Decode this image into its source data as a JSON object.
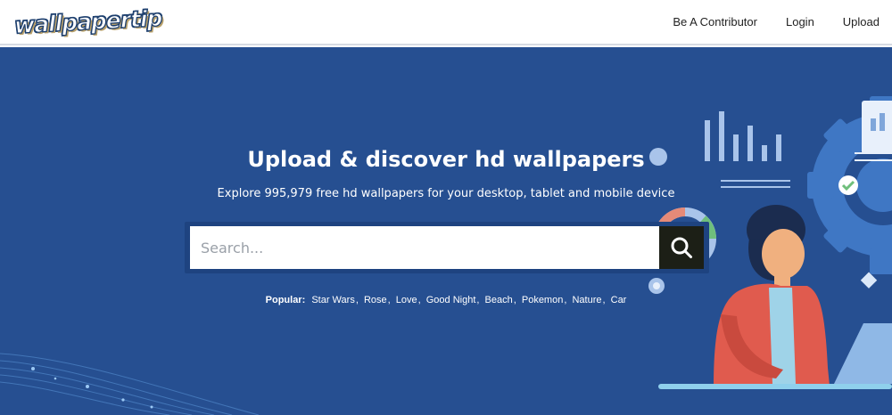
{
  "header": {
    "logo_text": "wallpapertip",
    "nav": [
      {
        "label": "Be A Contributor"
      },
      {
        "label": "Login"
      },
      {
        "label": "Upload"
      }
    ]
  },
  "hero": {
    "title": "Upload & discover hd wallpapers",
    "subtitle": "Explore 995,979 free hd wallpapers for your desktop, tablet and mobile device",
    "background_color": "#264f91"
  },
  "search": {
    "placeholder": "Search...",
    "value": "",
    "button_icon": "search-icon"
  },
  "popular": {
    "label": "Popular:",
    "tags": [
      "Star Wars",
      "Rose",
      "Love",
      "Good Night",
      "Beach",
      "Pokemon",
      "Nature",
      "Car"
    ]
  }
}
